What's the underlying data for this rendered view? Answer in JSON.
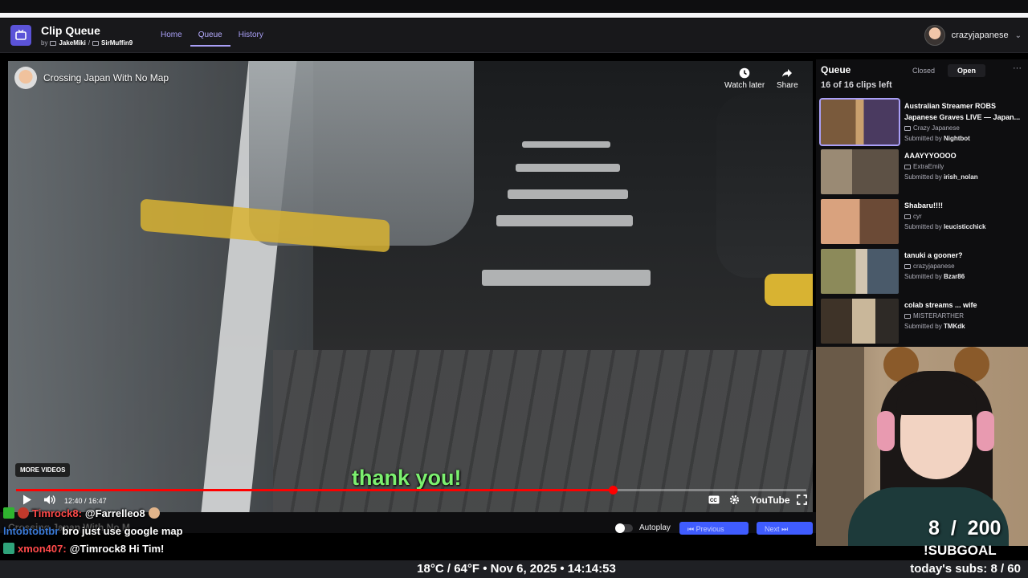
{
  "app": {
    "title": "Clip Queue",
    "by": "by",
    "author1": "JakeMiki",
    "separator": "/",
    "author2": "SirMuffin9",
    "nav": [
      {
        "label": "Home"
      },
      {
        "label": "Queue"
      },
      {
        "label": "History"
      }
    ],
    "active_nav": "Queue",
    "username": "crazyjapanese"
  },
  "video": {
    "title": "Crossing Japan With No Map",
    "watch_later": "Watch later",
    "share": "Share",
    "more_videos": "MORE VIDEOS",
    "caption": "thank you!",
    "time_current": "12:40",
    "time_sep": "/",
    "time_total": "16:47",
    "progress": 0.755,
    "youtube_label": "YouTube",
    "below_title": "Crossing Japan With No M...",
    "autoplay_label": "Autoplay",
    "previous_label": "Previous",
    "next_label": "Next"
  },
  "queue": {
    "title": "Queue",
    "clips_left": "16 of 16 clips left",
    "tabs": [
      {
        "label": "Closed"
      },
      {
        "label": "Open"
      }
    ],
    "active_tab": "Open",
    "more": "···",
    "submitted_by_prefix": "Submitted by",
    "clips": [
      {
        "title": "Australian Streamer ROBS Japanese Graves LIVE — Japan...",
        "channel": "Crazy Japanese",
        "submitter": "Nightbot"
      },
      {
        "title": "AAAYYYOOOO",
        "channel": "ExtraEmily",
        "submitter": "irish_nolan"
      },
      {
        "title": "Shabaru!!!!",
        "channel": "cyr",
        "submitter": "leucisticchick"
      },
      {
        "title": "tanuki a gooner?",
        "channel": "crazyjapanese",
        "submitter": "Bzar86"
      },
      {
        "title": "colab streams ... wife",
        "channel": "MISTERARTHER",
        "submitter": "TMKdk"
      }
    ]
  },
  "chat": [
    {
      "user": "Timrock8:",
      "message": "@Farrelleo8",
      "color": "#ff4a4a"
    },
    {
      "user": "lntobtobtbr",
      "message": "bro just use google map",
      "color": "#3a7ad8"
    },
    {
      "user": "xmon407:",
      "message": "@Timrock8 Hi Tim!",
      "color": "#ff4a4a"
    }
  ],
  "overlay": {
    "subgoal_current": "8",
    "subgoal_sep": "/",
    "subgoal_target": "200",
    "subgoal_label": "!SUBGOAL",
    "info": "18°C / 64°F • Nov 6, 2025 • 14:14:53",
    "todays_subs": "today's subs: 8 / 60"
  },
  "colors": {
    "accent": "#a99ff7",
    "logo": "#5b53d8",
    "caption": "#7cf06f",
    "progress": "#ff0000",
    "nav_button": "#3f5cff"
  }
}
